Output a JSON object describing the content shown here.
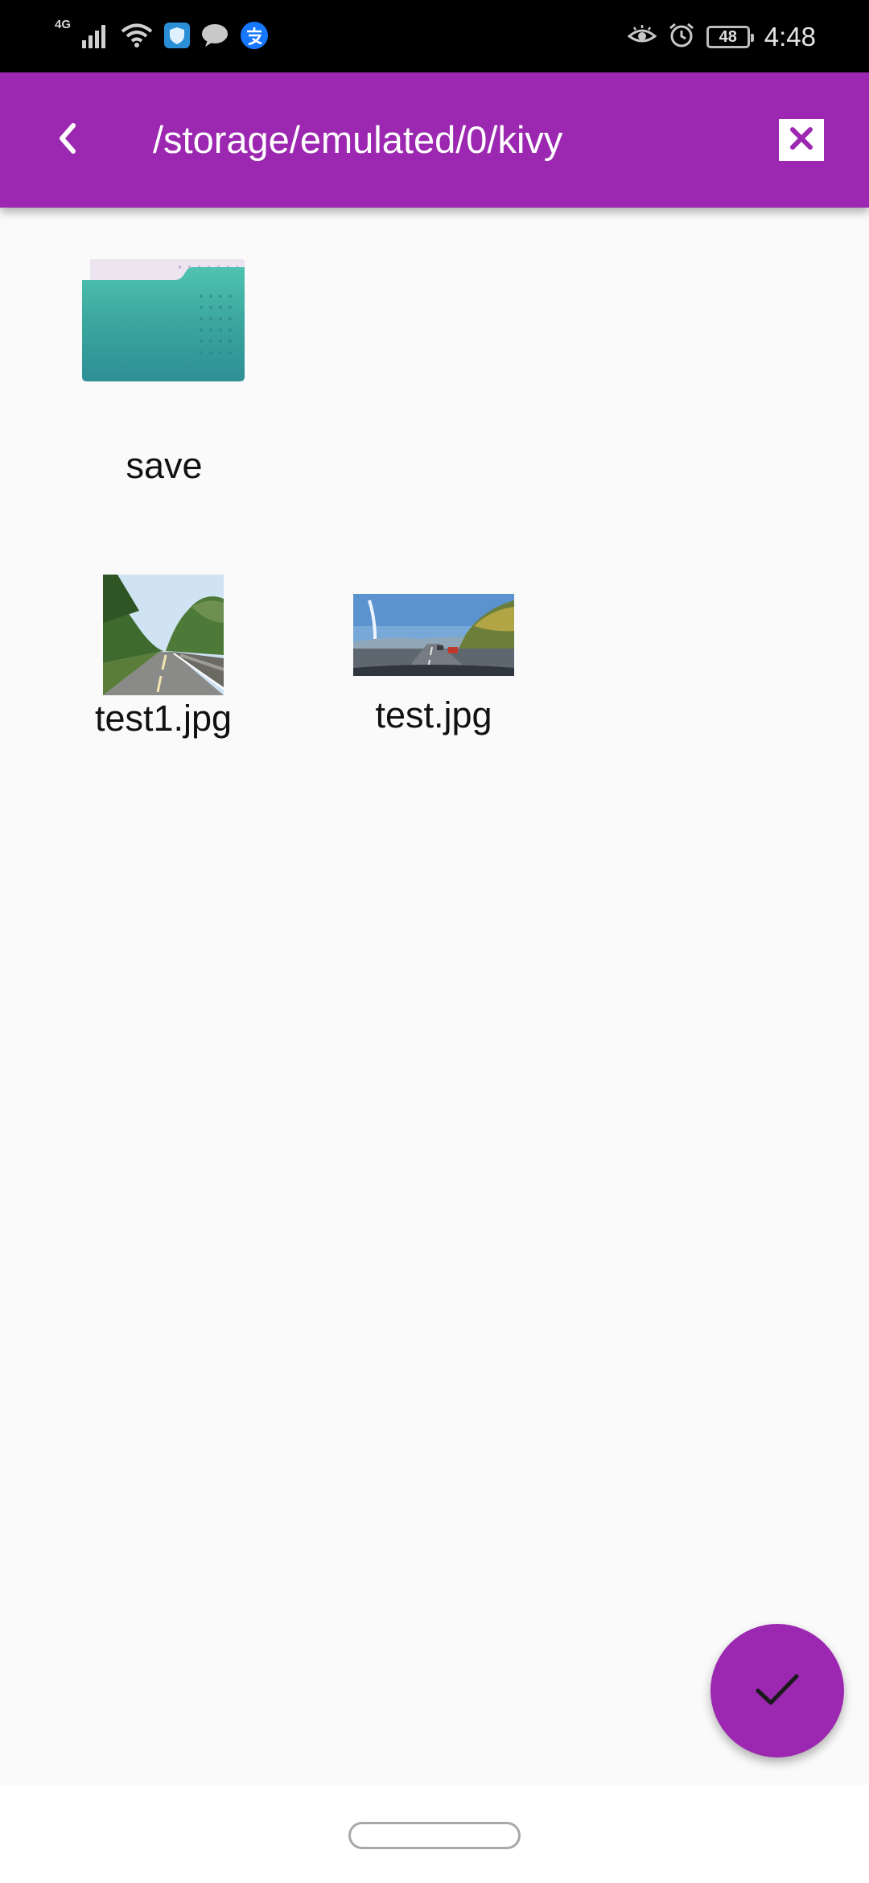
{
  "status_bar": {
    "network_type": "4G",
    "battery_level": "48",
    "time": "4:48",
    "left_icons": [
      "signal-icon",
      "wifi-icon",
      "shield-app-icon",
      "chat-icon",
      "alipay-icon"
    ],
    "right_icons": [
      "eye-icon",
      "alarm-icon"
    ]
  },
  "app_bar": {
    "title": "/storage/emulated/0/kivy",
    "back_icon": "chevron-left-icon",
    "close_icon": "close-icon",
    "background_color": "#9c27b0"
  },
  "files": [
    {
      "name": "save",
      "type": "folder",
      "icon": "folder-icon"
    },
    {
      "name": "test1.jpg",
      "type": "image",
      "icon": "image-thumbnail"
    },
    {
      "name": "test.jpg",
      "type": "image",
      "icon": "image-thumbnail"
    }
  ],
  "fab": {
    "icon": "check-icon",
    "color": "#9c27b0"
  },
  "nav_bar": {
    "home_indicator": "home-pill"
  }
}
